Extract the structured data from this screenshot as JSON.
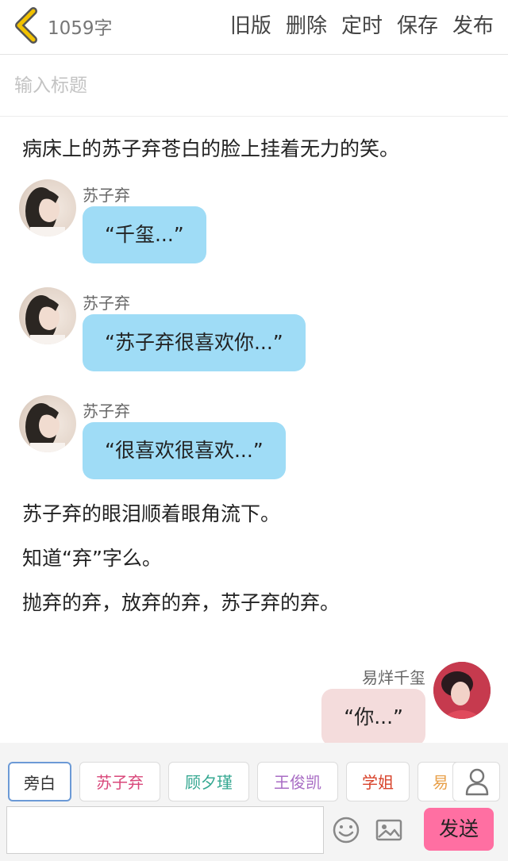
{
  "header": {
    "word_count": "1059字",
    "actions": [
      "旧版",
      "删除",
      "定时",
      "保存",
      "发布"
    ]
  },
  "title_input": {
    "placeholder": "输入标题",
    "value": ""
  },
  "content": {
    "narration_top": "病床上的苏子弃苍白的脸上挂着无力的笑。",
    "messages": [
      {
        "speaker": "苏子弃",
        "text": "“千玺...”",
        "side": "left"
      },
      {
        "speaker": "苏子弃",
        "text": "“苏子弃很喜欢你...”",
        "side": "left"
      },
      {
        "speaker": "苏子弃",
        "text": "“很喜欢很喜欢...”",
        "side": "left"
      },
      {
        "speaker": "易烊千玺",
        "text": "“你...”",
        "side": "right"
      }
    ],
    "narration_mid": [
      "苏子弃的眼泪顺着眼角流下。",
      "知道“弃”字么。",
      "抛弃的弃，放弃的弃，苏子弃的弃。"
    ]
  },
  "characters": [
    {
      "name": "旁白",
      "color": "#333333"
    },
    {
      "name": "苏子弃",
      "color": "#d9477a"
    },
    {
      "name": "顾夕瑾",
      "color": "#36a892"
    },
    {
      "name": "王俊凯",
      "color": "#a86cc4"
    },
    {
      "name": "学姐",
      "color": "#d8432b"
    },
    {
      "name": "易",
      "color": "#e8a04a"
    }
  ],
  "composer": {
    "input_placeholder": "",
    "input_value": "",
    "send_label": "发送"
  },
  "colors": {
    "left_bubble": "#9fdcf6",
    "right_bubble": "#f4dcdc",
    "send_button": "#ff6fa2",
    "back_arrow": "#f2c200"
  },
  "icons": {
    "back": "chevron-left-icon",
    "emoji": "smiley-icon",
    "image": "image-icon",
    "role": "person-icon"
  }
}
